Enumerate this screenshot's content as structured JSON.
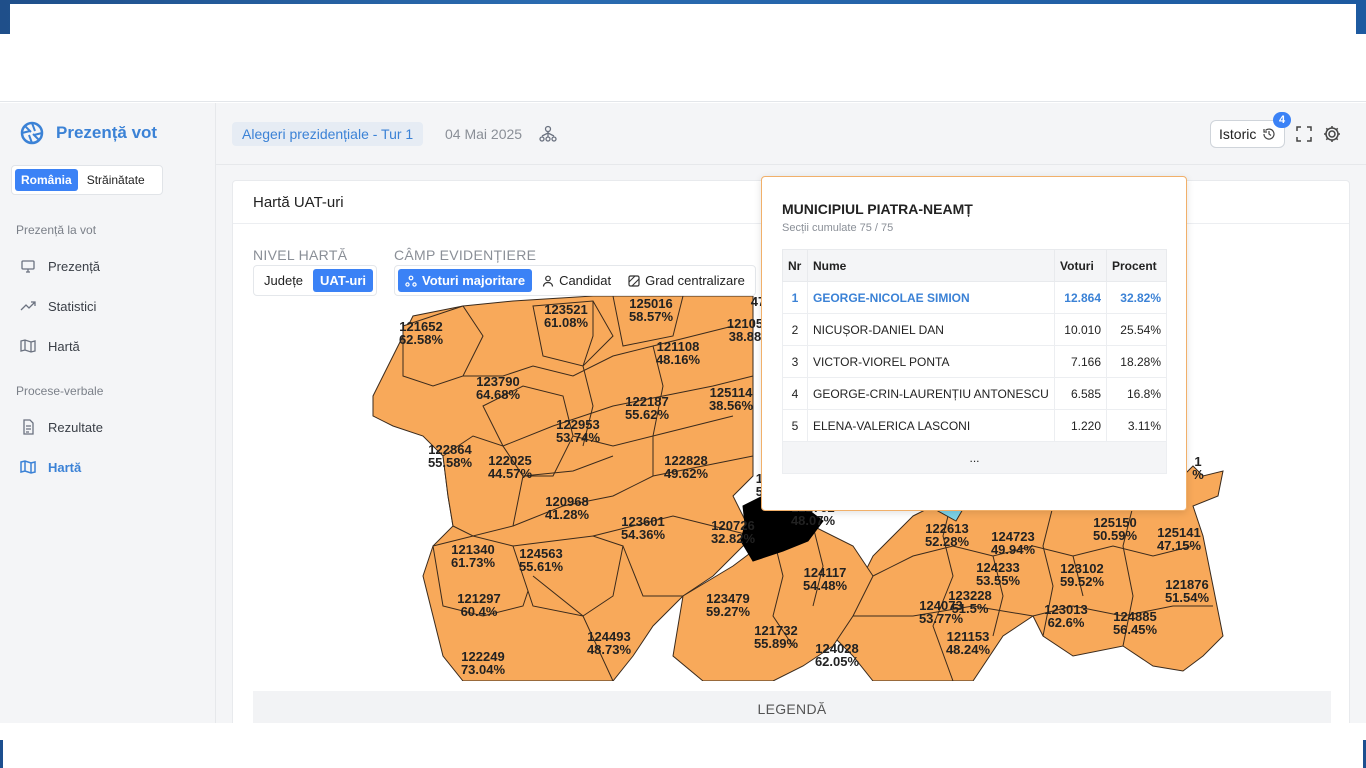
{
  "brand": {
    "title": "Prezență vot"
  },
  "region_toggle": {
    "options": [
      "România",
      "Străinătate"
    ],
    "selected": "România"
  },
  "sidebar": {
    "section1": "Prezență la vot",
    "items1": [
      {
        "label": "Prezență",
        "icon": "monitor-icon"
      },
      {
        "label": "Statistici",
        "icon": "trend-icon"
      },
      {
        "label": "Hartă",
        "icon": "map-icon"
      }
    ],
    "section2": "Procese-verbale",
    "items2": [
      {
        "label": "Rezultate",
        "icon": "document-icon"
      },
      {
        "label": "Hartă",
        "icon": "map-icon",
        "active": true
      }
    ]
  },
  "header": {
    "election": "Alegeri prezidențiale - Tur 1",
    "date": "04 Mai 2025",
    "istoric_label": "Istoric",
    "istoric_badge": "4"
  },
  "card": {
    "title": "Hartă UAT-uri",
    "nivel_label": "NIVEL HARTĂ",
    "nivel_options": [
      "Județe",
      "UAT-uri"
    ],
    "nivel_selected": "UAT-uri",
    "camp_label": "CÂMP EVIDENȚIERE",
    "camp_options": [
      "Voturi majoritare",
      "Candidat",
      "Grad centralizare"
    ],
    "camp_selected": "Voturi majoritare",
    "legend_label": "LEGENDĂ"
  },
  "map_labels": [
    {
      "id": "121652",
      "pct": "62.58%"
    },
    {
      "id": "123521",
      "pct": "61.08%"
    },
    {
      "id": "125016",
      "pct": "58.57%"
    },
    {
      "id": "12105",
      "pct": "38.88"
    },
    {
      "id": "121108",
      "pct": "48.16%"
    },
    {
      "id": "123790",
      "pct": "64.68%"
    },
    {
      "id": "122187",
      "pct": "55.62%"
    },
    {
      "id": "125114",
      "pct": "38.56%"
    },
    {
      "id": "122953",
      "pct": "53.74%"
    },
    {
      "id": "122864",
      "pct": "55.58%"
    },
    {
      "id": "122025",
      "pct": "44.57%"
    },
    {
      "id": "122828",
      "pct": "49.62%"
    },
    {
      "id": "120968",
      "pct": "41.28%"
    },
    {
      "id": "123601",
      "pct": "54.36%"
    },
    {
      "id": "120726",
      "pct": "32.82%"
    },
    {
      "id": "122702",
      "pct": "48.07%"
    },
    {
      "id": "121340",
      "pct": "61.73%"
    },
    {
      "id": "124563",
      "pct": "55.61%"
    },
    {
      "id": "121297",
      "pct": "60.4%"
    },
    {
      "id": "124117",
      "pct": "54.48%"
    },
    {
      "id": "123479",
      "pct": "59.27%"
    },
    {
      "id": "124493",
      "pct": "48.73%"
    },
    {
      "id": "121732",
      "pct": "55.89%"
    },
    {
      "id": "124028",
      "pct": "62.05%"
    },
    {
      "id": "122249",
      "pct": "73.04%"
    },
    {
      "id": "122613",
      "pct": "52.28%"
    },
    {
      "id": "124723",
      "pct": "49.94%"
    },
    {
      "id": "124233",
      "pct": "53.55%"
    },
    {
      "id": "123228",
      "pct": "51.5%"
    },
    {
      "id": "124073",
      "pct": "53.77%"
    },
    {
      "id": "121153",
      "pct": "48.24%"
    },
    {
      "id": "125150",
      "pct": "50.59%"
    },
    {
      "id": "125141",
      "pct": "47.15%"
    },
    {
      "id": "123102",
      "pct": "59.52%"
    },
    {
      "id": "121876",
      "pct": "51.54%"
    },
    {
      "id": "123013",
      "pct": "62.6%"
    },
    {
      "id": "124885",
      "pct": "56.45%"
    },
    {
      "id": "12",
      "pct": "50"
    },
    {
      "id": "47",
      "pct": ""
    },
    {
      "id": "1",
      "pct": "%"
    }
  ],
  "tooltip": {
    "title": "MUNICIPIUL PIATRA-NEAMȚ",
    "subtitle": "Secții cumulate 75 / 75",
    "columns": [
      "Nr",
      "Nume",
      "Voturi",
      "Procent"
    ],
    "rows": [
      {
        "nr": "1",
        "name": "GEORGE-NICOLAE SIMION",
        "votes": "12.864",
        "pct": "32.82%"
      },
      {
        "nr": "2",
        "name": "NICUȘOR-DANIEL DAN",
        "votes": "10.010",
        "pct": "25.54%"
      },
      {
        "nr": "3",
        "name": "VICTOR-VIOREL PONTA",
        "votes": "7.166",
        "pct": "18.28%"
      },
      {
        "nr": "4",
        "name": "GEORGE-CRIN-LAURENȚIU ANTONESCU",
        "votes": "6.585",
        "pct": "16.8%"
      },
      {
        "nr": "5",
        "name": "ELENA-VALERICA LASCONI",
        "votes": "1.220",
        "pct": "3.11%"
      }
    ],
    "more": "..."
  },
  "colors": {
    "accent": "#3b82f6",
    "map_fill": "#f8a95a",
    "map_highlight": "#000000",
    "tooltip_border": "#f1b06a"
  }
}
